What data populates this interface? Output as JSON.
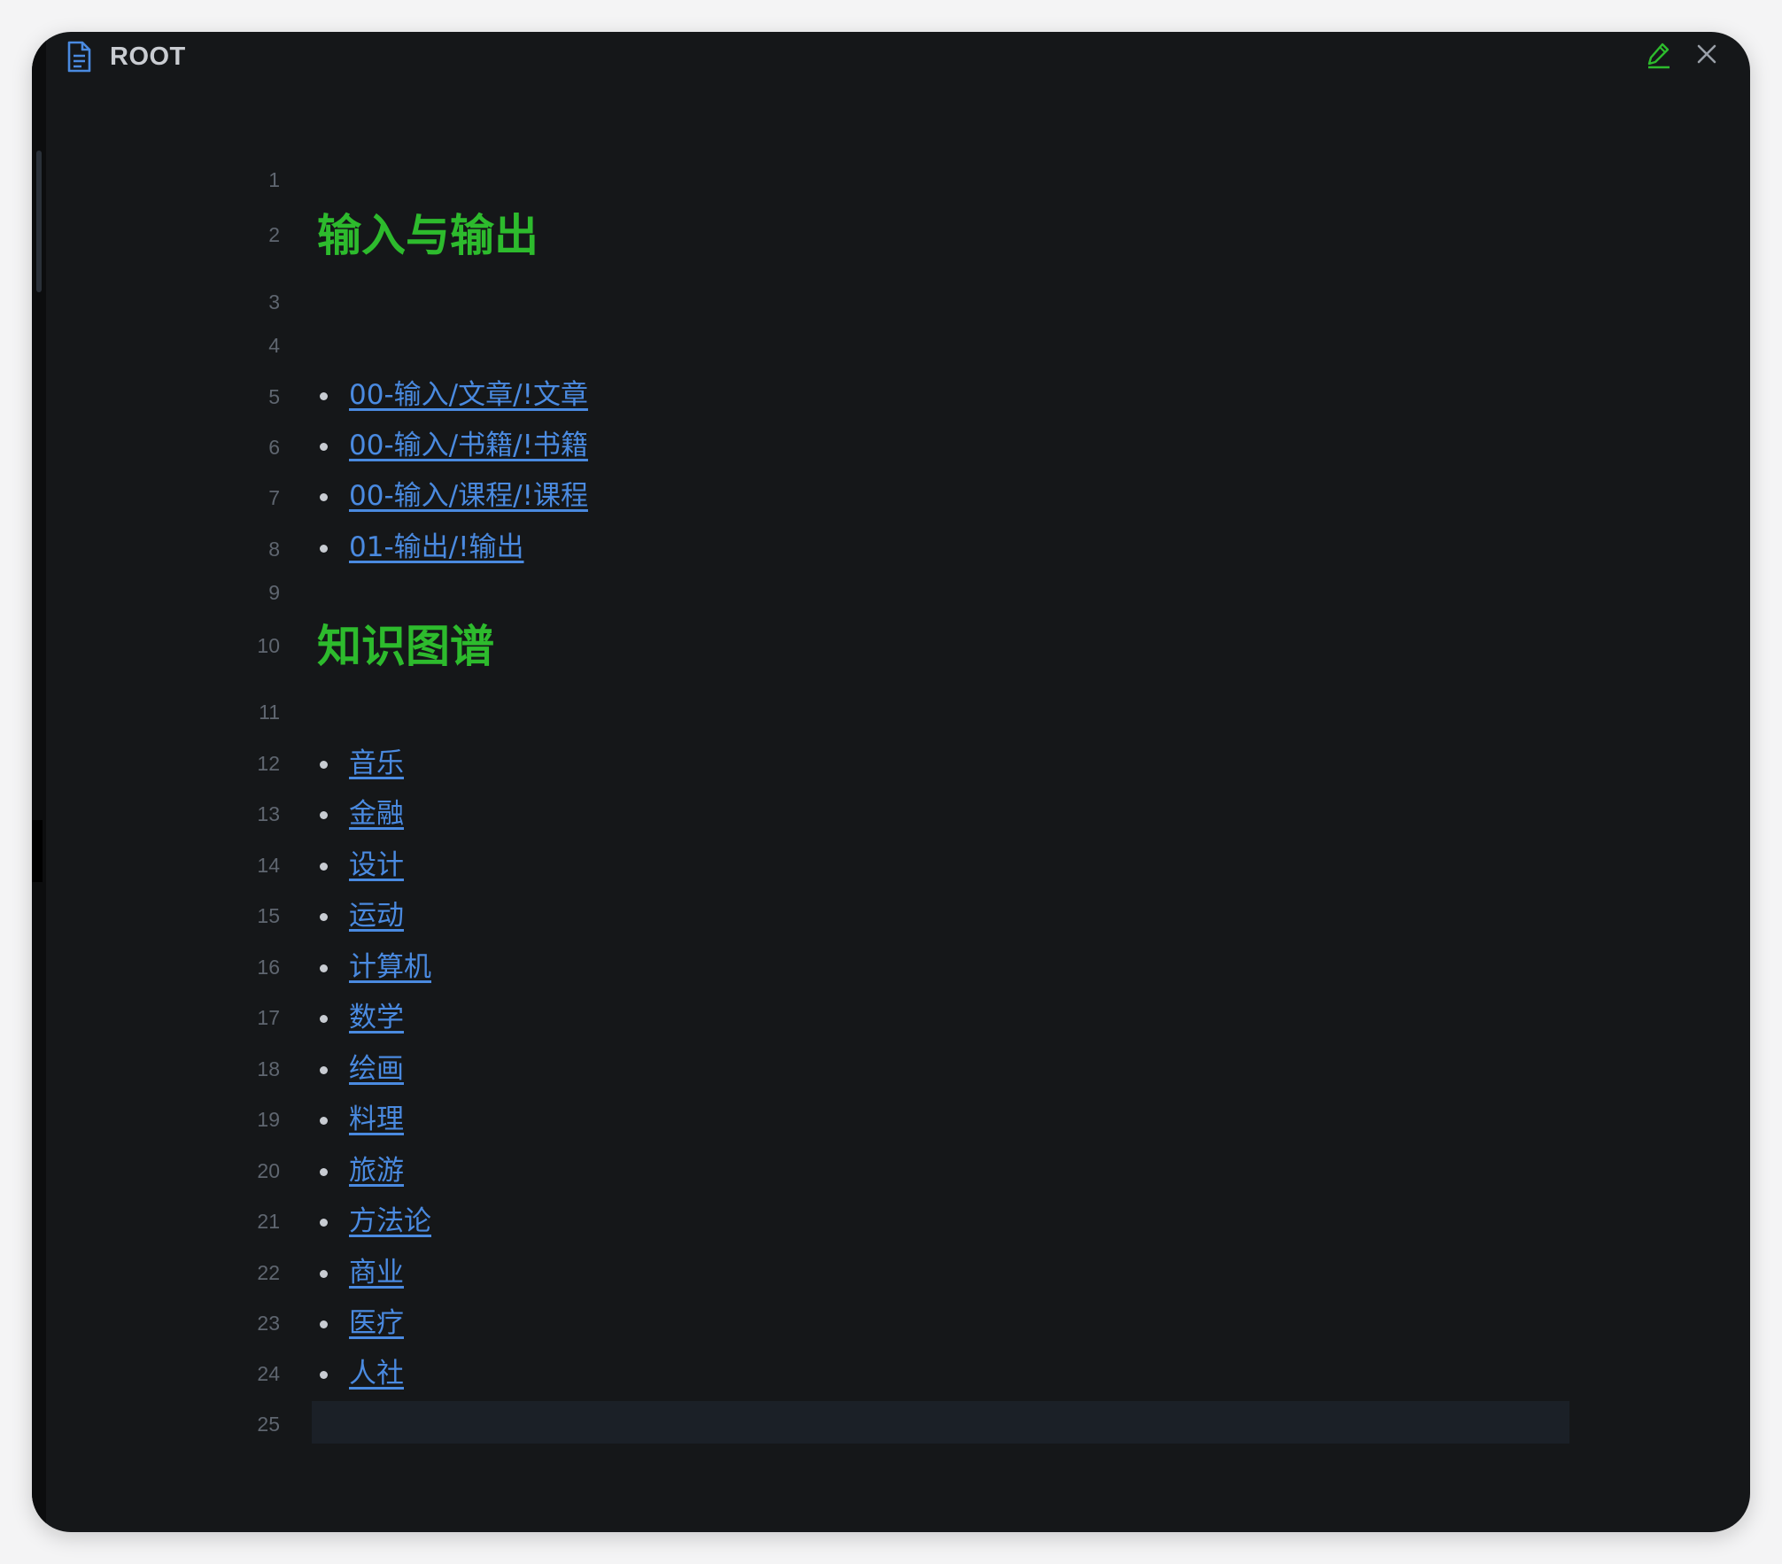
{
  "window": {
    "title": "ROOT",
    "accent_color": "#2dbb2d",
    "link_color": "#4a8ae0",
    "icons": [
      "document-icon",
      "edit-pencil-icon",
      "close-icon"
    ]
  },
  "editor": {
    "line_numbers": [
      "1",
      "2",
      "3",
      "4",
      "5",
      "6",
      "7",
      "8",
      "9",
      "10",
      "11",
      "12",
      "13",
      "14",
      "15",
      "16",
      "17",
      "18",
      "19",
      "20",
      "21",
      "22",
      "23",
      "24",
      "25"
    ],
    "sections": [
      {
        "heading": "输入与输出",
        "links": [
          "00-输入/文章/!文章",
          "00-输入/书籍/!书籍",
          "00-输入/课程/!课程",
          "01-输出/!输出"
        ]
      },
      {
        "heading": "知识图谱",
        "links": [
          "音乐",
          "金融",
          "设计",
          "运动",
          "计算机",
          "数学",
          "绘画",
          "料理",
          "旅游",
          "方法论",
          "商业",
          "医疗",
          "人社"
        ]
      }
    ],
    "active_line": "25"
  }
}
